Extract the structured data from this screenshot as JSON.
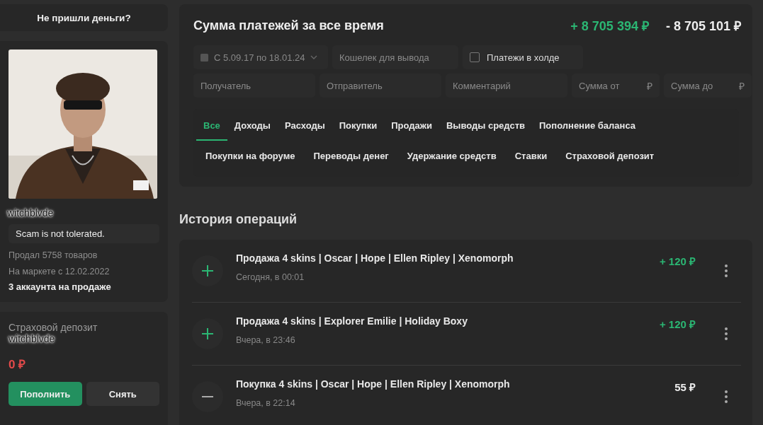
{
  "sidebar": {
    "help_button": "Не пришли деньги?",
    "profile": {
      "username": "witchblvde",
      "status": "Scam is not tolerated.",
      "sold": "Продал 5758 товаров",
      "since": "На маркете с 12.02.2022",
      "accounts": "3 аккаунта на продаже"
    },
    "deposit": {
      "title": "Страховой депозит",
      "username": "witchblvde",
      "amount": "0 ₽",
      "buttons": [
        {
          "label": "Пополнить",
          "kind": "primary"
        },
        {
          "label": "Снять",
          "kind": "secondary"
        }
      ]
    }
  },
  "summary": {
    "title": "Сумма платежей за все время",
    "income": "+ 8 705 394 ₽",
    "expense": "- 8 705 101 ₽",
    "date_range": "С 5.09.17 по 18.01.24",
    "wallet": {
      "placeholder": "Кошелек для вывода"
    },
    "hold": {
      "label": "Платежи в холде",
      "checked": false
    },
    "fields": [
      {
        "placeholder": "Получатель",
        "kind": "text"
      },
      {
        "placeholder": "Отправитель",
        "kind": "text"
      },
      {
        "placeholder": "Комментарий",
        "kind": "text"
      },
      {
        "placeholder": "Сумма от",
        "kind": "money",
        "currency": "₽"
      },
      {
        "placeholder": "Сумма до",
        "kind": "money",
        "currency": "₽"
      }
    ],
    "tabs": [
      {
        "label": "Все",
        "selected": true
      },
      {
        "label": "Доходы",
        "selected": false
      },
      {
        "label": "Расходы",
        "selected": false
      },
      {
        "label": "Покупки",
        "selected": false
      },
      {
        "label": "Продажи",
        "selected": false
      },
      {
        "label": "Выводы средств",
        "selected": false
      },
      {
        "label": "Пополнение баланса",
        "selected": false
      },
      {
        "label": "Покупки на форуме",
        "selected": false
      },
      {
        "label": "Переводы денег",
        "selected": false
      },
      {
        "label": "Удержание средств",
        "selected": false
      },
      {
        "label": "Ставки",
        "selected": false
      },
      {
        "label": "Страховой депозит",
        "selected": false
      }
    ]
  },
  "history": {
    "title": "История операций",
    "operations": [
      {
        "kind": "income",
        "title": "Продажа 4 skins | Oscar | Hope | Ellen Ripley | Xenomorph",
        "time": "Сегодня, в 00:01",
        "amount": "+ 120 ₽"
      },
      {
        "kind": "income",
        "title": "Продажа 4 skins | Explorer Emilie | Holiday Boxy",
        "time": "Вчера, в 23:46",
        "amount": "+ 120 ₽"
      },
      {
        "kind": "expense",
        "title": "Покупка 4 skins | Oscar | Hope | Ellen Ripley | Xenomorph",
        "time": "Вчера, в 22:14",
        "amount": "55 ₽"
      }
    ]
  }
}
